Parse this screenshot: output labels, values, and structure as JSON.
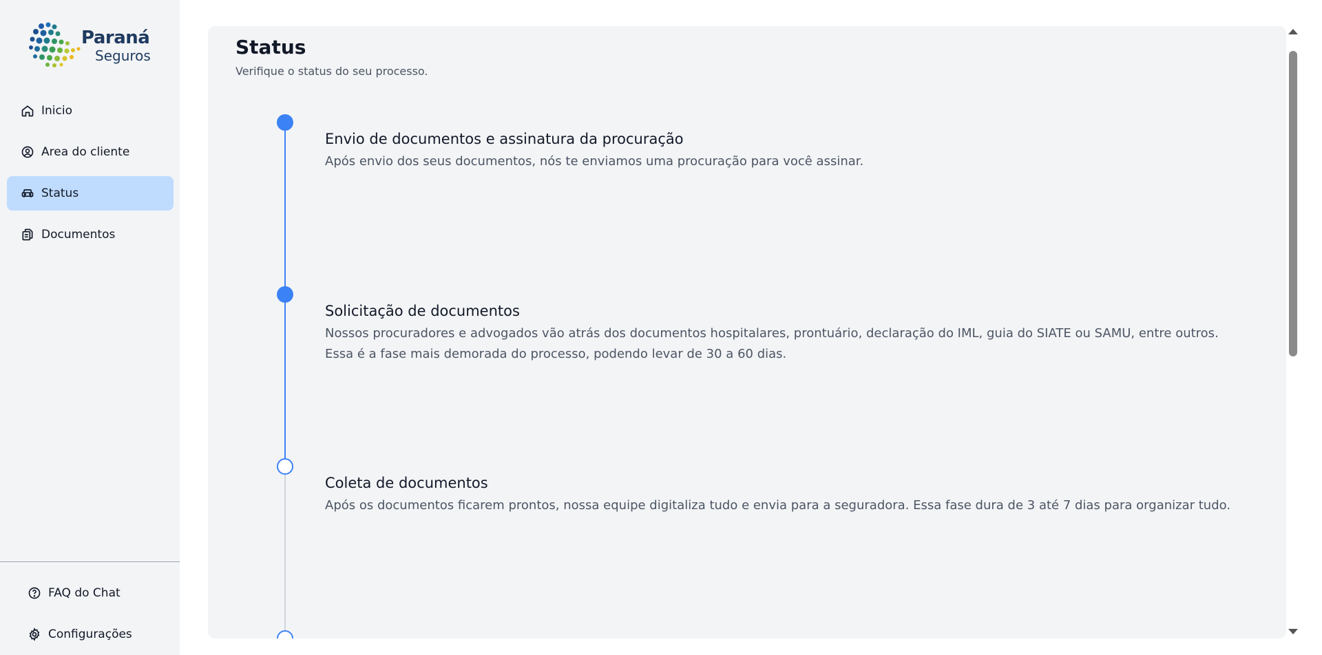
{
  "brand": {
    "name": "Paraná",
    "sub": "Seguros"
  },
  "sidebar": {
    "items": [
      {
        "label": "Inicio",
        "icon": "home-icon"
      },
      {
        "label": "Area do cliente",
        "icon": "user-circle-icon"
      },
      {
        "label": "Status",
        "icon": "car-icon",
        "active": true
      },
      {
        "label": "Documentos",
        "icon": "documents-icon"
      }
    ],
    "bottom": [
      {
        "label": "FAQ do Chat",
        "icon": "question-circle-icon"
      },
      {
        "label": "Configurações",
        "icon": "gear-icon"
      }
    ]
  },
  "main": {
    "title": "Status",
    "subtitle": "Verifique o status do seu processo.",
    "steps": [
      {
        "title": "Envio de documentos e assinatura da procuração",
        "description": "Após envio dos seus documentos, nós te enviamos uma procuração para você assinar.",
        "state": "done"
      },
      {
        "title": "Solicitação de documentos",
        "description": "Nossos procuradores e advogados vão atrás dos documentos hospitalares, prontuário, declaração do IML, guia do SIATE ou SAMU, entre outros. Essa é a fase mais demorada do processo, podendo levar de 30 a 60 dias.",
        "state": "done"
      },
      {
        "title": "Coleta de documentos",
        "description": "Após os documentos ficarem prontos, nossa equipe digitaliza tudo e envia para a seguradora. Essa fase dura de 3 até 7 dias para organizar tudo.",
        "state": "pending"
      },
      {
        "title": "",
        "description": "",
        "state": "pending"
      }
    ]
  },
  "colors": {
    "accent": "#3b82f6",
    "active_nav": "#bfdbfe",
    "panel": "#f3f4f6"
  }
}
